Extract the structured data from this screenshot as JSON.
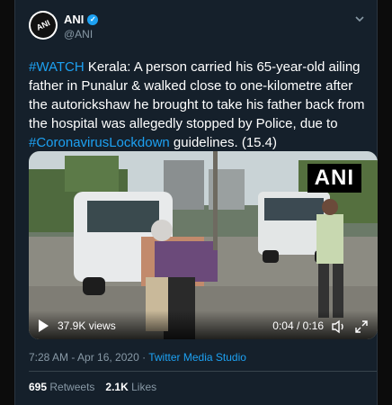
{
  "tweet": {
    "author_name": "ANI",
    "author_handle": "@ANI",
    "avatar_text": "ANI",
    "text_parts": [
      {
        "text": "#WATCH",
        "link": true
      },
      {
        "text": " Kerala: A person carried his 65-year-old ailing father in Punalur & walked close to one-kilometre after the autorickshaw he brought to take his father back from the hospital was allegedly stopped by Police, due to ",
        "link": false
      },
      {
        "text": "#CoronavirusLockdown",
        "link": true
      },
      {
        "text": " guidelines. (15.4)",
        "link": false
      }
    ]
  },
  "media": {
    "watermark": "ANI",
    "views": "37.9K views",
    "time": "0:04 / 0:16"
  },
  "meta": {
    "timestamp": "7:28 AM - Apr 16, 2020",
    "separator": " · ",
    "source": "Twitter Media Studio"
  },
  "stats": {
    "retweets_count": "695",
    "retweets_label": "Retweets",
    "likes_count": "2.1K",
    "likes_label": "Likes"
  },
  "colors": {
    "background": "#15202b",
    "link": "#1da1f2",
    "secondary_text": "#8899a6"
  },
  "icons": [
    "verified-badge-icon",
    "chevron-down-icon",
    "play-icon",
    "volume-icon",
    "fullscreen-icon"
  ]
}
